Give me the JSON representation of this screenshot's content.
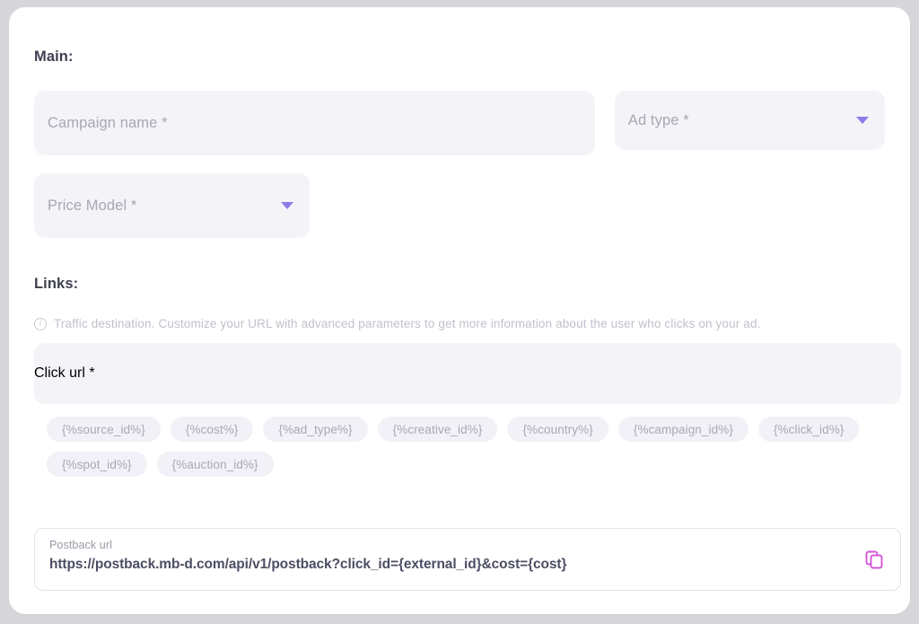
{
  "main": {
    "heading": "Main:",
    "fields": [
      {
        "label": "Campaign name",
        "required": "*",
        "type": "text"
      },
      {
        "label": "Ad type",
        "required": "*",
        "type": "select"
      },
      {
        "label": "Price Model",
        "required": "*",
        "type": "select"
      }
    ]
  },
  "links": {
    "heading": "Links:",
    "hint": "Traffic destination. Customize your URL with advanced parameters to get more information about the user who clicks on your ad.",
    "info_icon": "info-icon",
    "click_url": {
      "label": "Click url",
      "required": "*"
    },
    "macros": [
      "{%source_id%}",
      "{%cost%}",
      "{%ad_type%}",
      "{%creative_id%}",
      "{%country%}",
      "{%campaign_id%}",
      "{%click_id%}",
      "{%spot_id%}",
      "{%auction_id%}"
    ]
  },
  "postback": {
    "label": "Postback url",
    "value": "https://postback.mb-d.com/api/v1/postback?click_id={external_id}&cost={cost}",
    "copy_icon": "copy-icon"
  },
  "colors": {
    "page_bg": "#d6d6db",
    "card_bg": "#ffffff",
    "field_bg": "#f4f3f8",
    "tag_bg": "#f2f1f7",
    "heading": "#3f4050",
    "placeholder": "#a8a7b4",
    "hint": "#c2c1cc",
    "caret_purple": "#8b7ce8",
    "copy_magenta": "#d455d9",
    "postback_border": "#e3e2ee",
    "postback_value": "#4d4e63"
  }
}
